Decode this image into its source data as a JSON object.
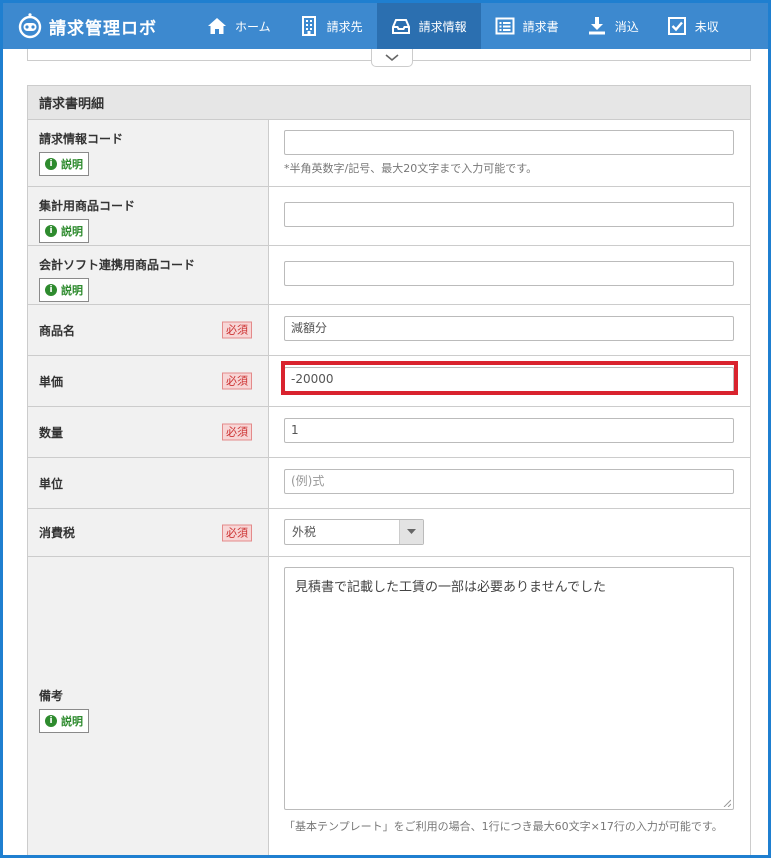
{
  "app": {
    "title": "請求管理ロボ"
  },
  "nav": [
    {
      "label": "ホーム",
      "icon": "home-icon"
    },
    {
      "label": "請求先",
      "icon": "building-icon"
    },
    {
      "label": "請求情報",
      "icon": "inbox-icon",
      "active": true
    },
    {
      "label": "請求書",
      "icon": "list-icon"
    },
    {
      "label": "消込",
      "icon": "download-icon"
    },
    {
      "label": "未収",
      "icon": "checkbox-icon"
    }
  ],
  "section": {
    "title": "請求書明細"
  },
  "labels": {
    "explain": "説明",
    "required": "必須"
  },
  "fields": {
    "billing_code": {
      "label": "請求情報コード",
      "value": "",
      "hint": "*半角英数字/記号、最大20文字まで入力可能です。"
    },
    "agg_product_code": {
      "label": "集計用商品コード",
      "value": ""
    },
    "accounting_product_code": {
      "label": "会計ソフト連携用商品コード",
      "value": ""
    },
    "product_name": {
      "label": "商品名",
      "value": "減額分"
    },
    "unit_price": {
      "label": "単価",
      "value": "-20000"
    },
    "quantity": {
      "label": "数量",
      "value": "1"
    },
    "unit": {
      "label": "単位",
      "placeholder": "(例)式"
    },
    "tax": {
      "label": "消費税",
      "value": "外税"
    },
    "remarks": {
      "label": "備考",
      "value": "見積書で記載した工賃の一部は必要ありませんでした",
      "hint": "「基本テンプレート」をご利用の場合、1行につき最大60文字×17行の入力が可能です。"
    }
  },
  "colors": {
    "header": "#3d89cf",
    "header_active": "#2b6fb0",
    "highlight": "#d9232e",
    "explain_green": "#2e8b2e"
  }
}
